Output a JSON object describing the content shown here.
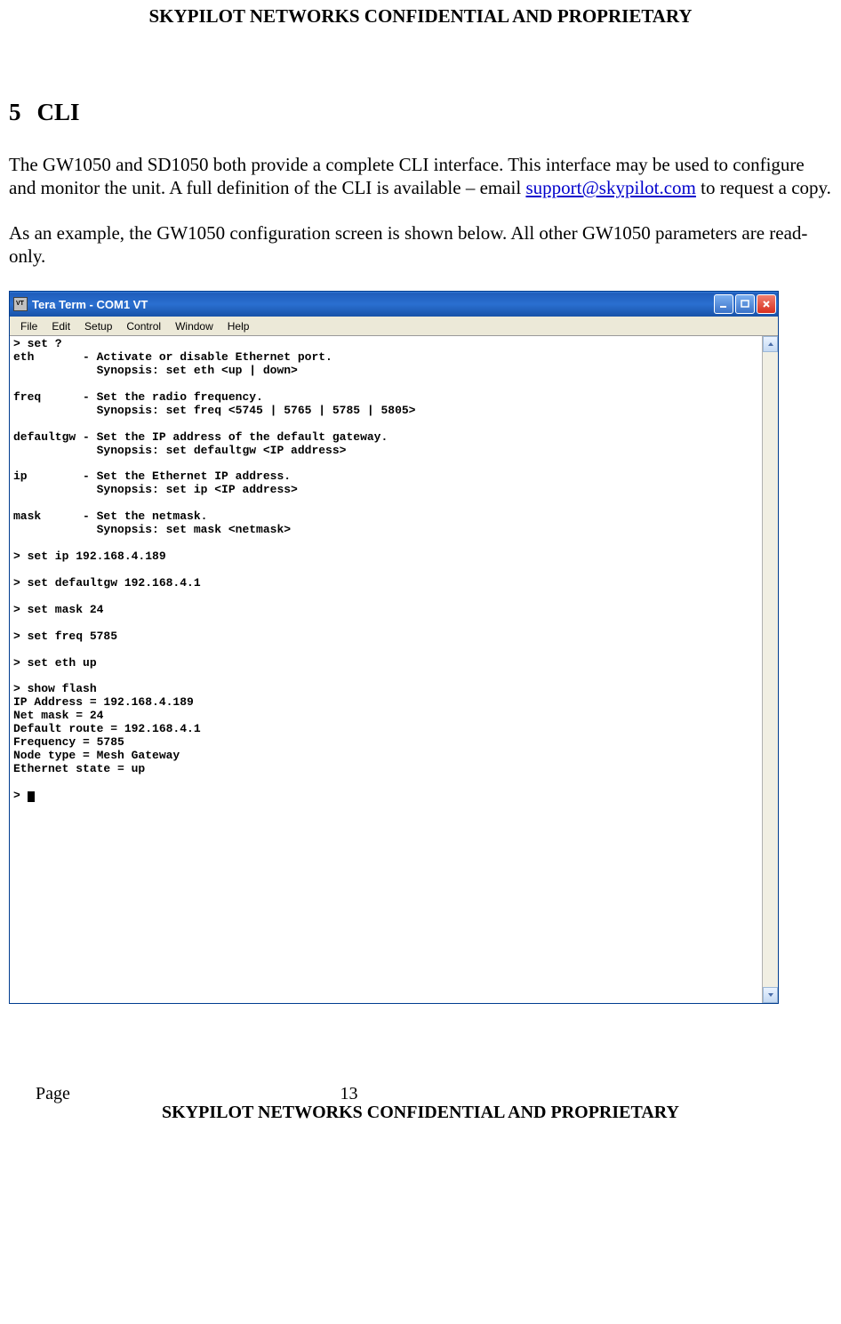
{
  "header": {
    "confidential": "SKYPILOT NETWORKS CONFIDENTIAL AND PROPRIETARY"
  },
  "section": {
    "number": "5",
    "title": "CLI"
  },
  "paragraphs": {
    "p1_a": "The GW1050 and SD1050 both provide a complete CLI interface. This interface may be used to configure and monitor the unit. A full definition of the CLI is available – email ",
    "p1_email": "support@skypilot.com",
    "p1_b": " to request a copy.",
    "p2": "As an example, the GW1050 configuration screen is shown below. All other GW1050 parameters are read-only."
  },
  "terminal": {
    "title": "Tera Term - COM1 VT",
    "menu": {
      "file": "File",
      "edit": "Edit",
      "setup": "Setup",
      "control": "Control",
      "window": "Window",
      "help": "Help"
    },
    "text": "> set ?\neth       - Activate or disable Ethernet port.\n            Synopsis: set eth <up | down>\n\nfreq      - Set the radio frequency.\n            Synopsis: set freq <5745 | 5765 | 5785 | 5805>\n\ndefaultgw - Set the IP address of the default gateway.\n            Synopsis: set defaultgw <IP address>\n\nip        - Set the Ethernet IP address.\n            Synopsis: set ip <IP address>\n\nmask      - Set the netmask.\n            Synopsis: set mask <netmask>\n\n> set ip 192.168.4.189\n\n> set defaultgw 192.168.4.1\n\n> set mask 24\n\n> set freq 5785\n\n> set eth up\n\n> show flash\nIP Address = 192.168.4.189\nNet mask = 24\nDefault route = 192.168.4.1\nFrequency = 5785\nNode type = Mesh Gateway\nEthernet state = up\n\n> "
  },
  "footer": {
    "page_label": "Page",
    "page_num": "13",
    "confidential": "SKYPILOT NETWORKS CONFIDENTIAL AND PROPRIETARY"
  }
}
